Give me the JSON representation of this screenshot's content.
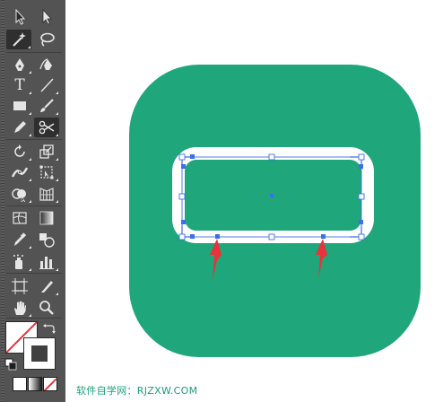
{
  "toolbar": {
    "tools": [
      {
        "name": "selection-tool",
        "icon": "arrow-icon"
      },
      {
        "name": "direct-selection-tool",
        "icon": "white-arrow-icon"
      },
      {
        "name": "magic-wand-tool",
        "icon": "magic-wand-icon",
        "active": true
      },
      {
        "name": "lasso-tool",
        "icon": "lasso-icon"
      },
      {
        "name": "pen-tool",
        "icon": "pen-icon"
      },
      {
        "name": "curvature-tool",
        "icon": "curvature-pen-icon"
      },
      {
        "name": "type-tool",
        "icon": "type-icon",
        "glyph": "T"
      },
      {
        "name": "line-segment-tool",
        "icon": "line-icon"
      },
      {
        "name": "rectangle-tool",
        "icon": "rectangle-icon"
      },
      {
        "name": "paintbrush-tool",
        "icon": "brush-icon"
      },
      {
        "name": "pencil-tool",
        "icon": "pencil-icon"
      },
      {
        "name": "scissors-tool",
        "icon": "scissors-icon",
        "active": true
      },
      {
        "name": "rotate-tool",
        "icon": "rotate-icon"
      },
      {
        "name": "scale-tool",
        "icon": "scale-icon"
      },
      {
        "name": "width-tool",
        "icon": "width-icon"
      },
      {
        "name": "free-transform-tool",
        "icon": "free-transform-icon"
      },
      {
        "name": "shape-builder-tool",
        "icon": "shape-builder-icon"
      },
      {
        "name": "perspective-grid-tool",
        "icon": "perspective-grid-icon"
      },
      {
        "name": "mesh-tool",
        "icon": "mesh-icon"
      },
      {
        "name": "gradient-tool",
        "icon": "gradient-icon"
      },
      {
        "name": "eyedropper-tool",
        "icon": "eyedropper-icon"
      },
      {
        "name": "blend-tool",
        "icon": "blend-icon"
      },
      {
        "name": "symbol-sprayer-tool",
        "icon": "symbol-sprayer-icon"
      },
      {
        "name": "column-graph-tool",
        "icon": "column-graph-icon"
      },
      {
        "name": "artboard-tool",
        "icon": "artboard-icon"
      },
      {
        "name": "slice-tool",
        "icon": "slice-icon"
      },
      {
        "name": "hand-tool",
        "icon": "hand-icon"
      },
      {
        "name": "zoom-tool",
        "icon": "zoom-icon"
      }
    ],
    "fill_state": "none",
    "stroke_color": "#404040"
  },
  "artwork": {
    "background_color": "#1fa67a",
    "inner_shape_fill": "#1fa67a",
    "inner_shape_stroke": "#ffffff",
    "selection_color": "#3d6fe8",
    "arrow_color": "#e8333a"
  },
  "caption": "软件自学网：RJZXW.COM"
}
